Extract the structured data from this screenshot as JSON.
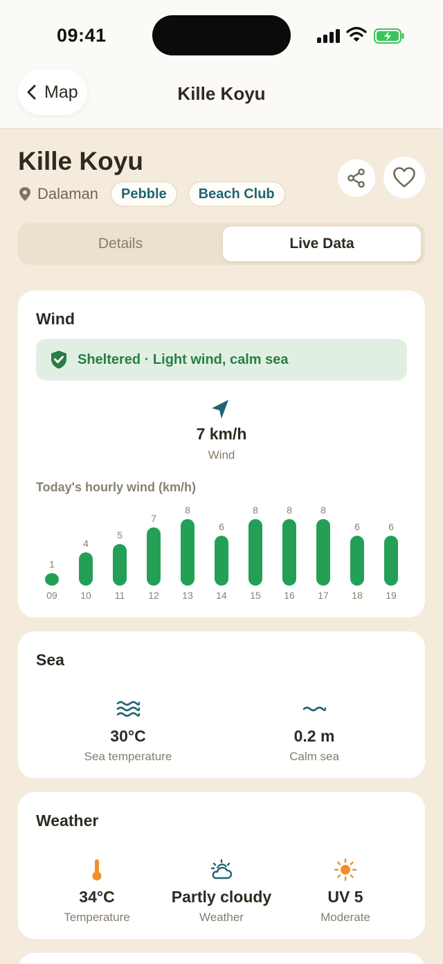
{
  "status_bar": {
    "time": "09:41"
  },
  "header": {
    "back_label": "Map",
    "title": "Kille Koyu"
  },
  "place": {
    "name": "Kille Koyu",
    "location": "Dalaman",
    "tags": [
      "Pebble",
      "Beach Club"
    ]
  },
  "tabs": [
    {
      "label": "Details",
      "selected": false
    },
    {
      "label": "Live Data",
      "selected": true
    }
  ],
  "wind": {
    "title": "Wind",
    "status": "Sheltered · Light wind, calm sea",
    "speed": "7 km/h",
    "speed_label": "Wind",
    "chart_caption": "Today's hourly wind (km/h)"
  },
  "chart_data": {
    "type": "bar",
    "title": "Today's hourly wind (km/h)",
    "categories": [
      "09",
      "10",
      "11",
      "12",
      "13",
      "14",
      "15",
      "16",
      "17",
      "18",
      "19"
    ],
    "values": [
      1,
      4,
      5,
      7,
      8,
      6,
      8,
      8,
      8,
      6,
      6
    ],
    "ylim": [
      0,
      8
    ],
    "color": "#23a055"
  },
  "sea": {
    "title": "Sea",
    "temperature": {
      "value": "30°C",
      "label": "Sea temperature",
      "icon": "waves-icon"
    },
    "waves": {
      "value": "0.2 m",
      "label": "Calm sea",
      "icon": "calm-wave-icon"
    }
  },
  "weather": {
    "title": "Weather",
    "temperature": {
      "value": "34°C",
      "label": "Temperature",
      "icon": "thermometer-icon"
    },
    "condition": {
      "value": "Partly cloudy",
      "label": "Weather",
      "icon": "partly-cloudy-icon"
    },
    "uv": {
      "value": "UV 5",
      "label": "Moderate",
      "icon": "sun-icon"
    }
  },
  "colors": {
    "background": "#f4ebdd",
    "accent_teal": "#1e6475",
    "bar_green": "#23a055",
    "status_green": "#2a7d45",
    "orange": "#f0902a"
  }
}
